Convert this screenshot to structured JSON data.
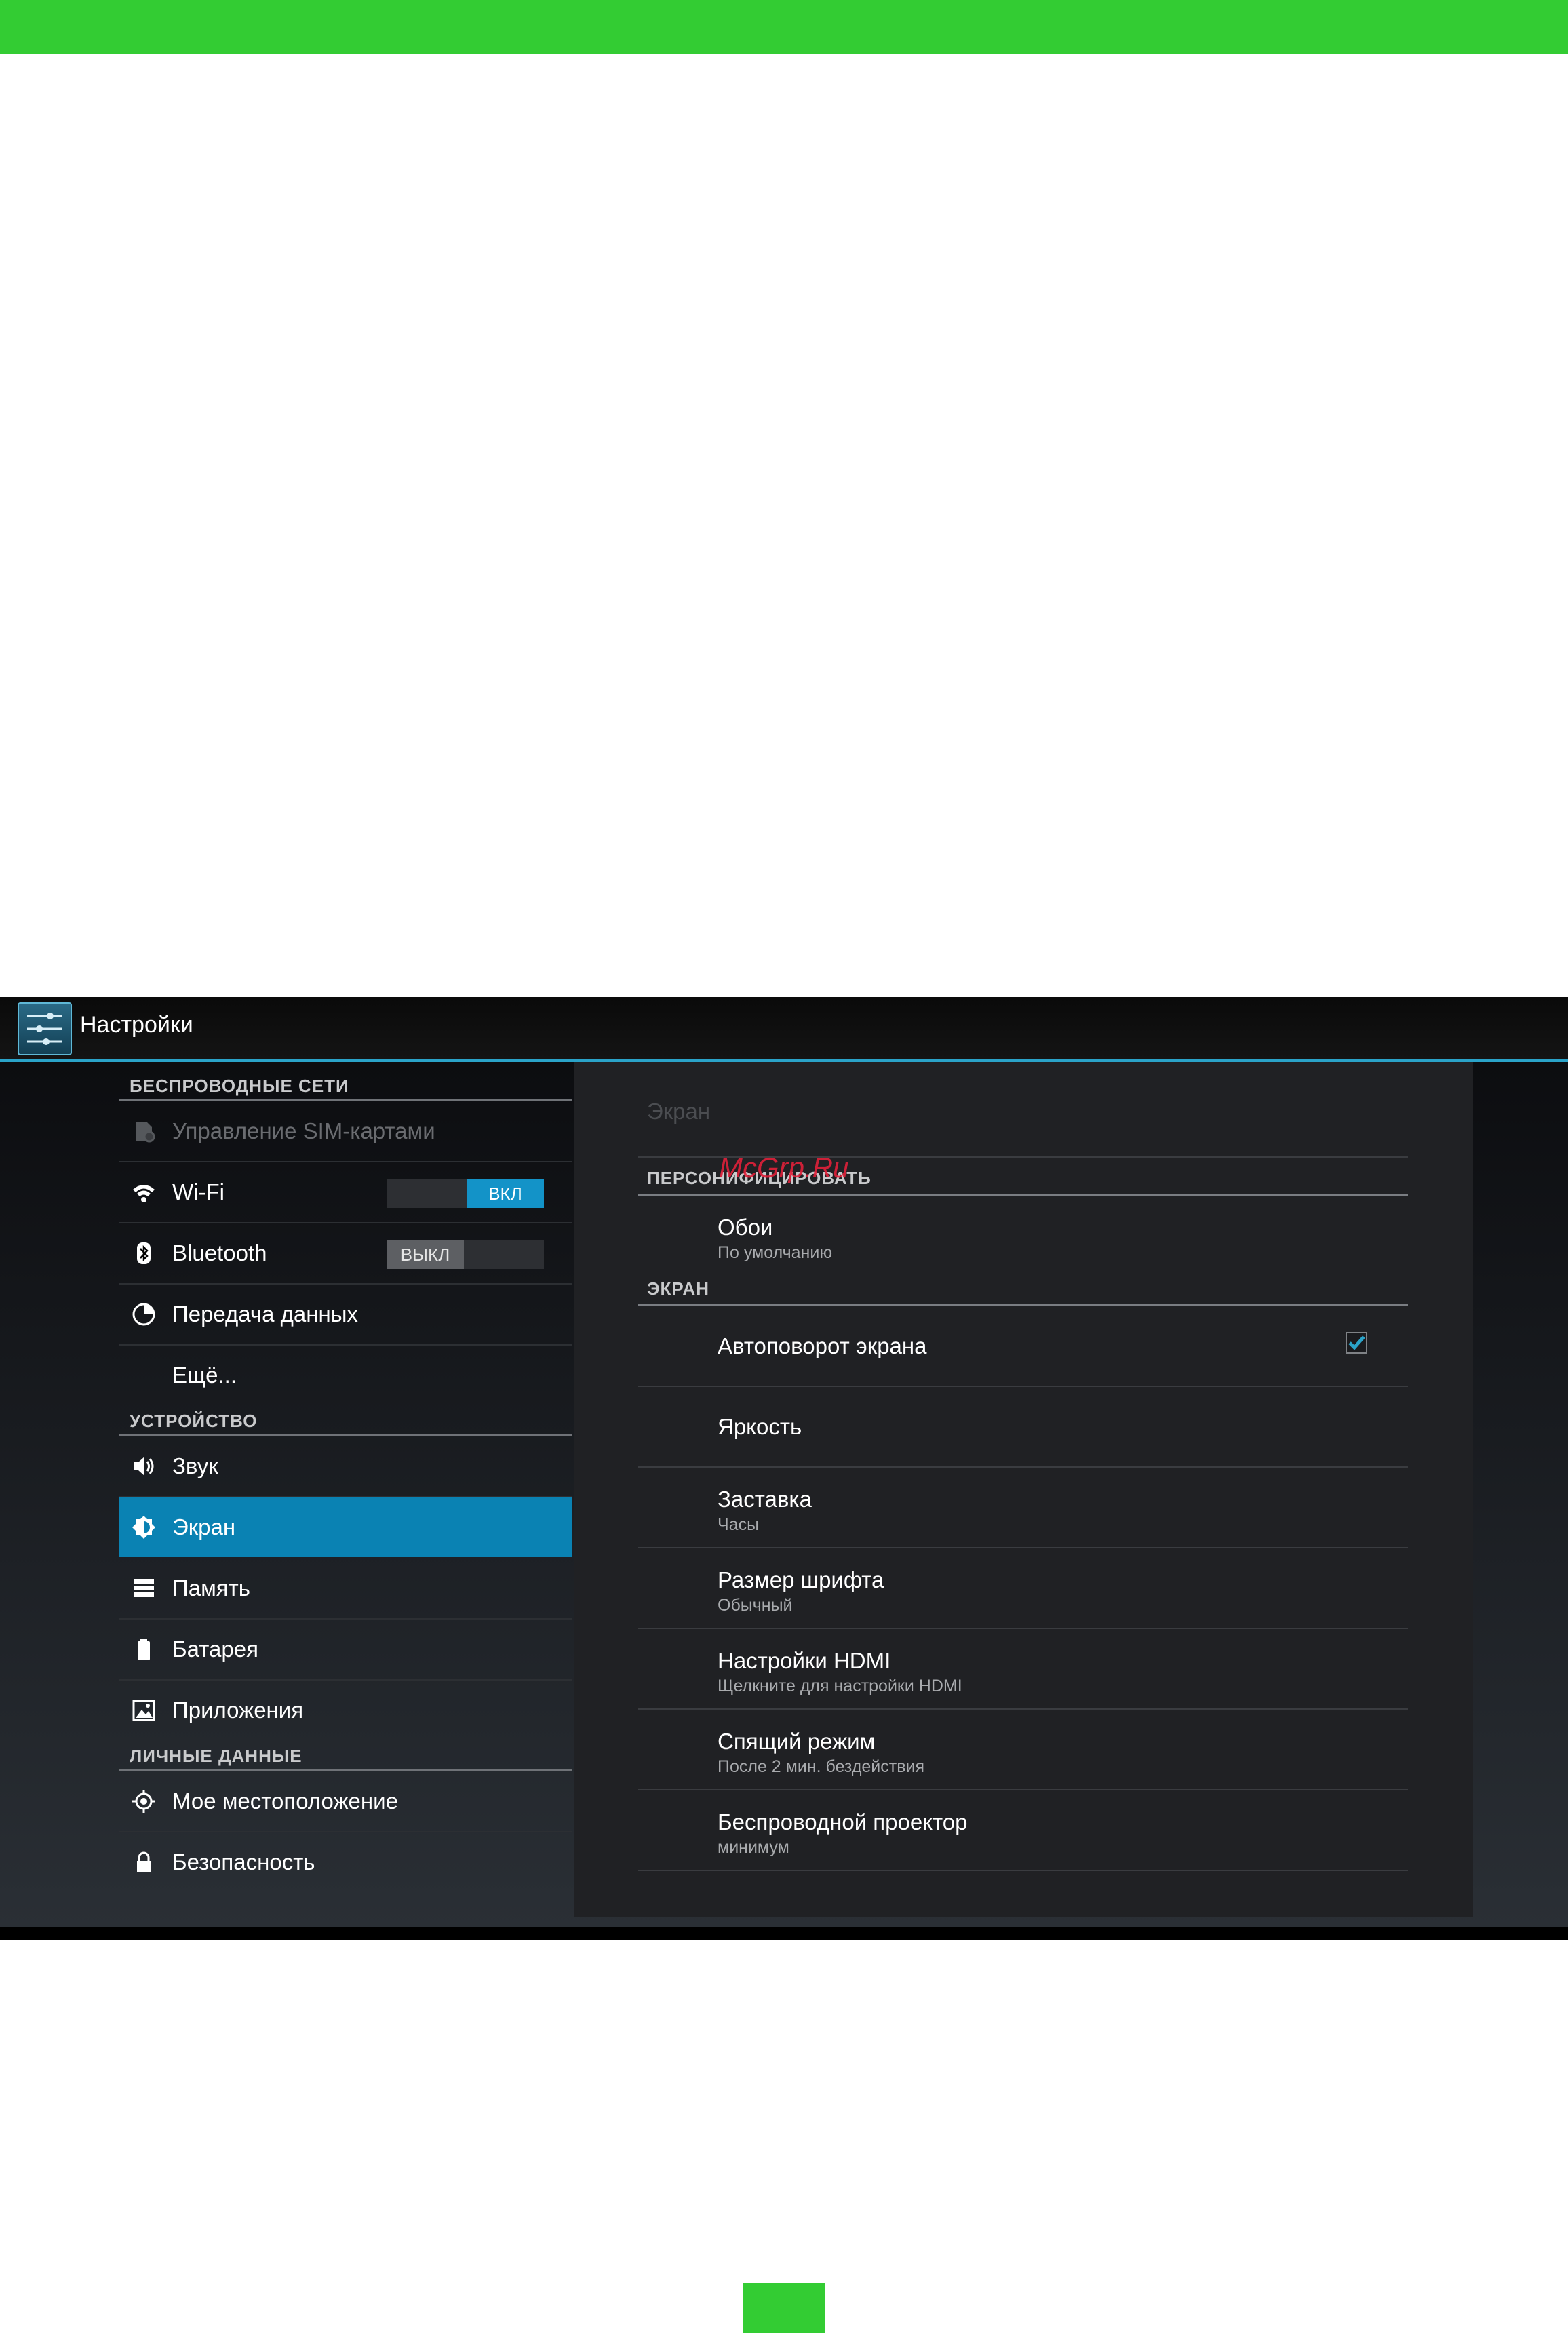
{
  "app": {
    "title": "Настройки"
  },
  "left": {
    "sections": [
      {
        "header": "БЕСПРОВОДНЫЕ СЕТИ"
      },
      {
        "header": "УСТРОЙСТВО"
      },
      {
        "header": "ЛИЧНЫЕ ДАННЫЕ"
      }
    ],
    "items": {
      "sim": "Управление SIM-картами",
      "wifi": "Wi-Fi",
      "wifi_toggle": "ВКЛ",
      "bluetooth": "Bluetooth",
      "bluetooth_toggle": "ВЫКЛ",
      "data": "Передача данных",
      "more": "Ещё...",
      "sound": "Звук",
      "screen": "Экран",
      "memory": "Память",
      "battery": "Батарея",
      "apps": "Приложения",
      "location": "Мое местоположение",
      "security": "Безопасность"
    },
    "selected": "screen"
  },
  "right": {
    "crumb": "Экран",
    "section_personalize": "ПЕРСОНИФИЦИРОВАТЬ",
    "section_screen": "ЭКРАН",
    "rows": {
      "wallpaper": {
        "title": "Обои",
        "sub": "По умолчанию"
      },
      "autorotate": {
        "title": "Автоповорот экрана",
        "checked": true
      },
      "brightness": {
        "title": "Яркость"
      },
      "screensaver": {
        "title": "Заставка",
        "sub": "Часы"
      },
      "fontsize": {
        "title": "Размер шрифта",
        "sub": "Обычный"
      },
      "hdmi": {
        "title": "Настройки HDMI",
        "sub": "Щелкните для настройки HDMI"
      },
      "sleep": {
        "title": "Спящий режим",
        "sub": "После 2 мин. бездействия"
      },
      "projector": {
        "title": "Беспроводной проектор",
        "sub": "минимум"
      }
    }
  },
  "watermark": "McGrp.Ru",
  "colors": {
    "accent": "#0a82b3",
    "brand_green": "#33cc33"
  }
}
